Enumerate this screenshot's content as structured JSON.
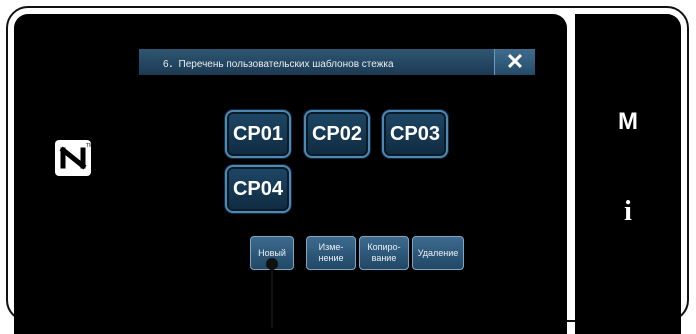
{
  "dialog": {
    "title": "6．Перечень пользовательских шаблонов стежка",
    "close_label": "✕"
  },
  "patterns": [
    "CP01",
    "CP02",
    "CP03",
    "CP04"
  ],
  "actions": {
    "new": "Новый",
    "edit_line1": "Изме-",
    "edit_line2": "нение",
    "copy_line1": "Копиро-",
    "copy_line2": "вание",
    "delete": "Удаление"
  },
  "side": {
    "mode_label": "M",
    "info_label": "i"
  },
  "icons": {
    "nfc": "nfc-icon",
    "close": "close-icon"
  }
}
